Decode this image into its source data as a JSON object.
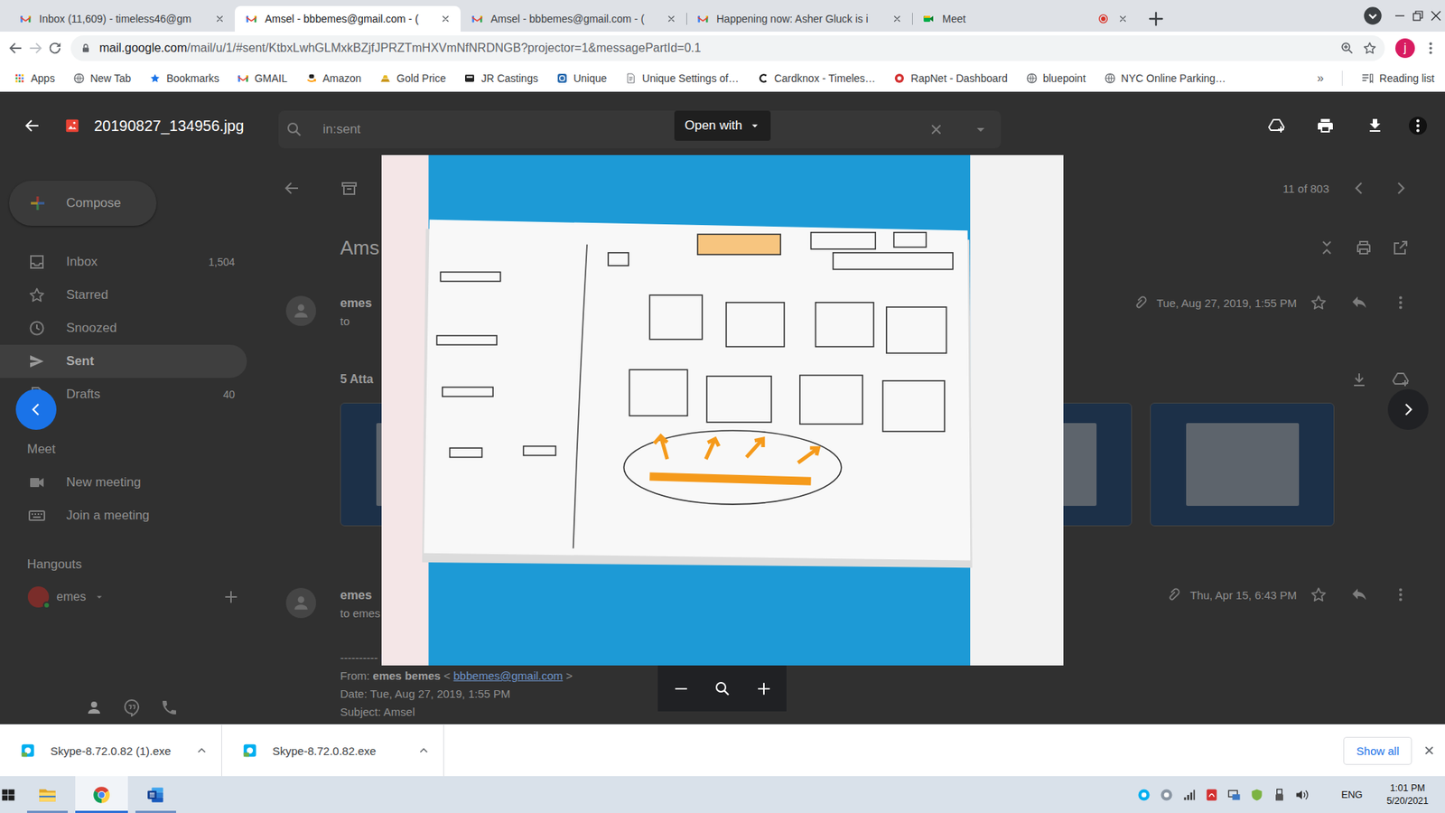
{
  "browser": {
    "tabs": [
      {
        "title": "Inbox (11,609) - timeless46@gm",
        "kind": "gmail",
        "selected": false,
        "recording": false
      },
      {
        "title": "Amsel - bbbemes@gmail.com - (",
        "kind": "gmail",
        "selected": true,
        "recording": false
      },
      {
        "title": "Amsel - bbbemes@gmail.com - (",
        "kind": "gmail",
        "selected": false,
        "recording": false
      },
      {
        "title": "Happening now: Asher Gluck is i",
        "kind": "gmail",
        "selected": false,
        "recording": false
      },
      {
        "title": "Meet",
        "kind": "meet",
        "selected": false,
        "recording": true
      }
    ],
    "url_host": "mail.google.com",
    "url_path": "/mail/u/1/#sent/KtbxLwhGLMxkBZjfJPRZTmHXVmNfNRDNGB?projector=1&messagePartId=0.1",
    "profile_initial": "j",
    "bookmarks": [
      {
        "label": "Apps",
        "kind": "apps"
      },
      {
        "label": "New Tab",
        "kind": "globe"
      },
      {
        "label": "Bookmarks",
        "kind": "star"
      },
      {
        "label": "GMAIL",
        "kind": "gmail"
      },
      {
        "label": "Amazon",
        "kind": "amazon"
      },
      {
        "label": "Gold Price",
        "kind": "gold"
      },
      {
        "label": "JR Castings",
        "kind": "jr"
      },
      {
        "label": "Unique",
        "kind": "unique"
      },
      {
        "label": "Unique Settings of…",
        "kind": "doc"
      },
      {
        "label": "Cardknox - Timeles…",
        "kind": "cardknox"
      },
      {
        "label": "RapNet - Dashboard",
        "kind": "rapnet"
      },
      {
        "label": "bluepoint",
        "kind": "globe"
      },
      {
        "label": "NYC Online Parking…",
        "kind": "globe"
      }
    ],
    "bookmarks_more": "»",
    "reading_list": "Reading list"
  },
  "viewer": {
    "file_name": "20190827_134956.jpg",
    "open_with": "Open with"
  },
  "gmail": {
    "search": "in:sent",
    "compose": "Compose",
    "nav": [
      {
        "label": "Inbox",
        "count": "1,504",
        "kind": "inbox",
        "selected": false
      },
      {
        "label": "Starred",
        "kind": "star",
        "selected": false
      },
      {
        "label": "Snoozed",
        "kind": "clock",
        "selected": false
      },
      {
        "label": "Sent",
        "kind": "send",
        "selected": true
      },
      {
        "label": "Drafts",
        "count": "40",
        "kind": "draft",
        "selected": false
      }
    ],
    "meet": {
      "heading": "Meet",
      "items": [
        {
          "label": "New meeting",
          "kind": "video"
        },
        {
          "label": "Join a meeting",
          "kind": "keyboard"
        }
      ]
    },
    "hangouts": {
      "heading": "Hangouts",
      "user": "emes"
    },
    "pager": "11 of 803",
    "subject": "Ams",
    "messages": [
      {
        "sender": "emes",
        "to": "to",
        "date": "Tue, Aug 27, 2019, 1:55 PM"
      },
      {
        "sender": "emes",
        "to": "to emes",
        "date": "Thu, Apr 15, 6:43 PM"
      }
    ],
    "attachments_label": "5 Atta",
    "forwarded": [
      [
        {
          "text": "---------- Forwarded message",
          "kind": "plain"
        }
      ],
      [
        {
          "text": "From:",
          "kind": "plain"
        },
        {
          "text": "emes bemes",
          "kind": "bold"
        },
        {
          "text": "<",
          "kind": "plain"
        },
        {
          "text": "bbbemes@gmail.com",
          "kind": "link"
        },
        {
          "text": ">",
          "kind": "plain"
        }
      ],
      [
        {
          "text": "Date: Tue, Aug 27, 2019, 1:55 PM",
          "kind": "plain"
        }
      ],
      [
        {
          "text": "Subject: Amsel",
          "kind": "plain"
        }
      ]
    ]
  },
  "downloads": {
    "items": [
      {
        "name": "Skype-8.72.0.82 (1).exe"
      },
      {
        "name": "Skype-8.72.0.82.exe"
      }
    ],
    "show_all": "Show all"
  },
  "taskbar": {
    "apps": [
      {
        "kind": "explorer",
        "selected": false
      },
      {
        "kind": "chrome",
        "selected": true
      },
      {
        "kind": "word",
        "selected": false
      }
    ],
    "language": "ENG",
    "time": "1:01 PM",
    "date": "5/20/2021"
  }
}
